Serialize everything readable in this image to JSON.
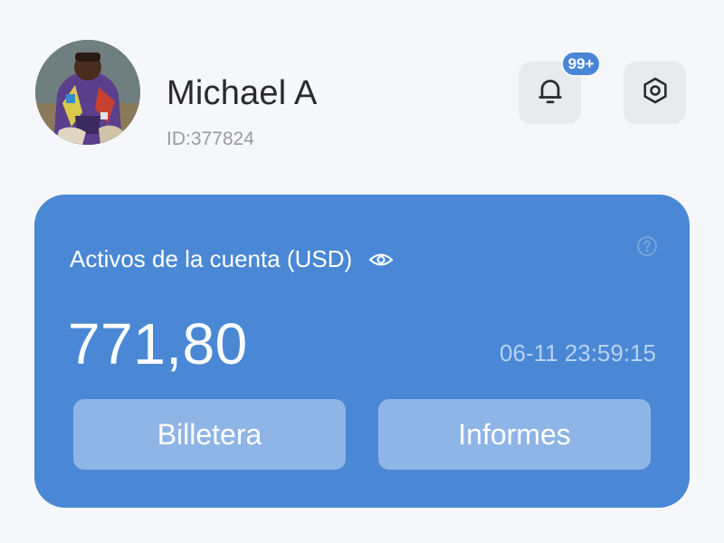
{
  "profile": {
    "name": "Michael A",
    "id_text": "ID:377824",
    "avatar_alt": "avatar"
  },
  "header": {
    "notification_badge": "99+",
    "icons": {
      "notifications": "bell-icon",
      "settings": "hexagon-settings-icon"
    }
  },
  "account_card": {
    "title": "Activos de la cuenta (USD)",
    "amount": "771,80",
    "timestamp": "06-11 23:59:15",
    "icons": {
      "visibility": "eye-icon",
      "help": "question-circle-icon"
    },
    "buttons": {
      "wallet": "Billetera",
      "reports": "Informes"
    }
  },
  "colors": {
    "background": "#f6f7fb",
    "card": "#4a88d5",
    "card_button": "#8fb5e6",
    "badge": "#4a86d6",
    "timestamp": "#b8d1f0",
    "icon_button": "#e9eaee"
  }
}
